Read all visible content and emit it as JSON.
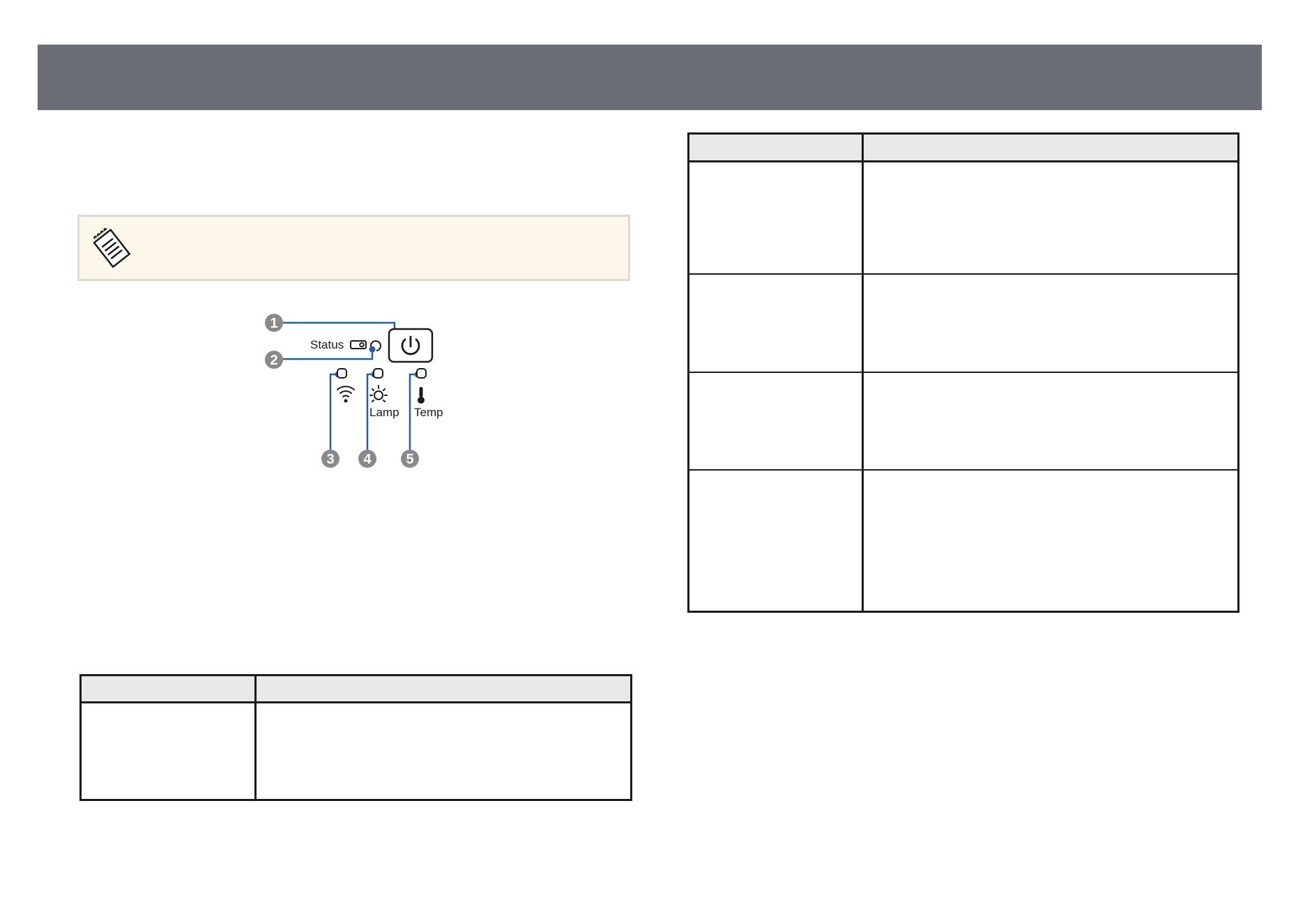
{
  "diagram": {
    "callouts": [
      "1",
      "2",
      "3",
      "4",
      "5"
    ],
    "status_label": "Status",
    "lamp_label": "Lamp",
    "temp_label": "Temp",
    "icons": [
      "power-icon",
      "projector-icon",
      "wifi-icon",
      "lamp-icon",
      "thermometer-icon"
    ],
    "accent_color": "#1f5fa8"
  },
  "note": {
    "icon": "note-pad-icon"
  },
  "colors": {
    "banner": "#6a6d76",
    "note_bg": "#fdf7ea",
    "table_header": "#e9e9e9"
  }
}
